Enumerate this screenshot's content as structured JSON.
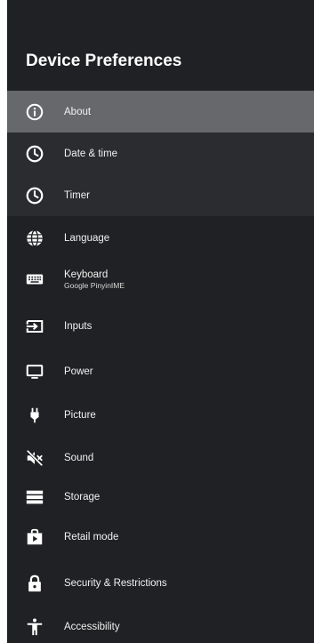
{
  "panel": {
    "title": "Device Preferences",
    "background": "#202124",
    "focus_color": "#67686c"
  },
  "menu": {
    "items": [
      {
        "label": "About",
        "icon": "info-icon",
        "state": "focused"
      },
      {
        "label": "Date & time",
        "icon": "clock-icon",
        "state": "dimmed"
      },
      {
        "label": "Timer",
        "icon": "timer-icon",
        "state": "dimmed"
      },
      {
        "label": "Language",
        "icon": "globe-icon",
        "state": "normal"
      },
      {
        "label": "Keyboard",
        "sublabel": "Google PinyinIME",
        "icon": "keyboard-icon",
        "state": "normal"
      },
      {
        "label": "Inputs",
        "icon": "input-icon",
        "state": "normal"
      },
      {
        "label": "Power",
        "icon": "monitor-icon",
        "state": "normal"
      },
      {
        "label": "Picture",
        "icon": "plug-icon",
        "state": "normal"
      },
      {
        "label": "Sound",
        "icon": "speaker-muted-icon",
        "state": "normal"
      },
      {
        "label": "Storage",
        "icon": "storage-icon",
        "state": "normal"
      },
      {
        "label": "Retail mode",
        "icon": "retail-bag-icon",
        "state": "normal"
      },
      {
        "label": "Security & Restrictions",
        "icon": "lock-icon",
        "state": "normal"
      },
      {
        "label": "Accessibility",
        "icon": "accessibility-icon",
        "state": "normal"
      }
    ]
  }
}
